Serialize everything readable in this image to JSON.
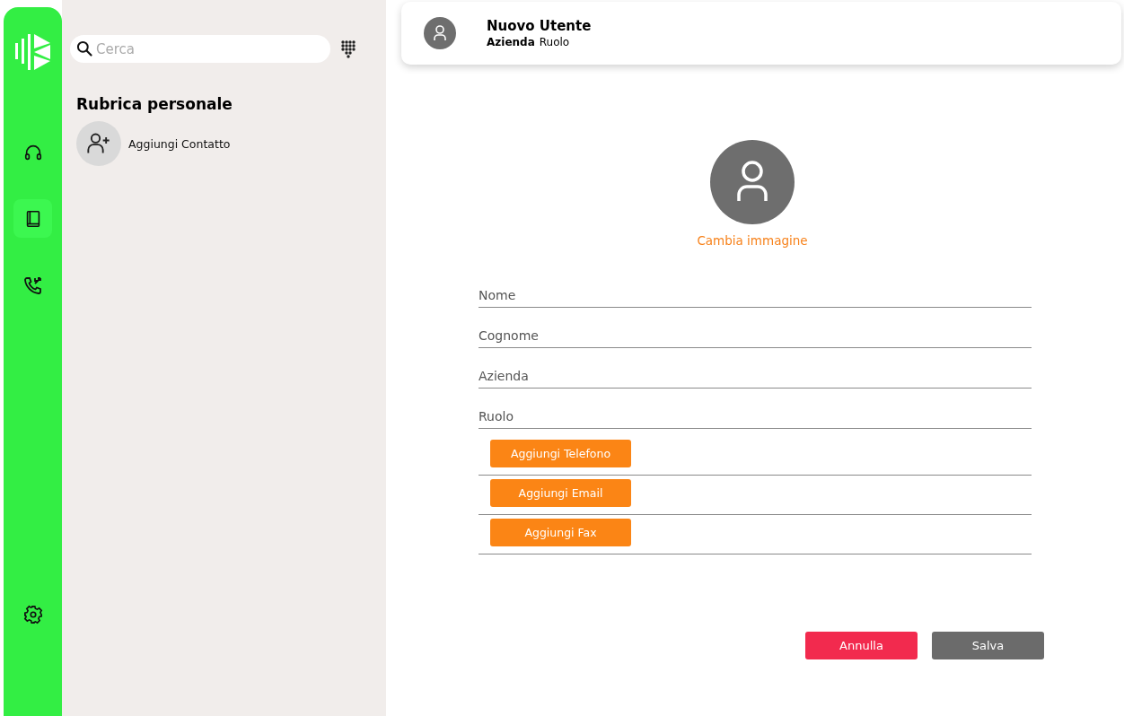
{
  "nav": [
    {
      "kind": "headset",
      "selected": false
    },
    {
      "kind": "book",
      "selected": true
    },
    {
      "kind": "calls",
      "selected": false
    }
  ],
  "search": {
    "placeholder": "Cerca"
  },
  "contacts_panel": {
    "title": "Rubrica personale",
    "add_contact": "Aggiungi Contatto"
  },
  "header": {
    "name": "Nuovo Utente",
    "company": "Azienda",
    "role": "Ruolo"
  },
  "form": {
    "change_image": "Cambia immagine",
    "fields": [
      {
        "placeholder": "Nome"
      },
      {
        "placeholder": "Cognome"
      },
      {
        "placeholder": "Azienda"
      },
      {
        "placeholder": "Ruolo"
      }
    ],
    "add_buttons": [
      "Aggiungi Telefono",
      "Aggiungi Email",
      "Aggiungi Fax"
    ]
  },
  "actions": [
    {
      "label": "Annulla",
      "kind": "cancel"
    },
    {
      "label": "Salva",
      "kind": "save"
    }
  ]
}
